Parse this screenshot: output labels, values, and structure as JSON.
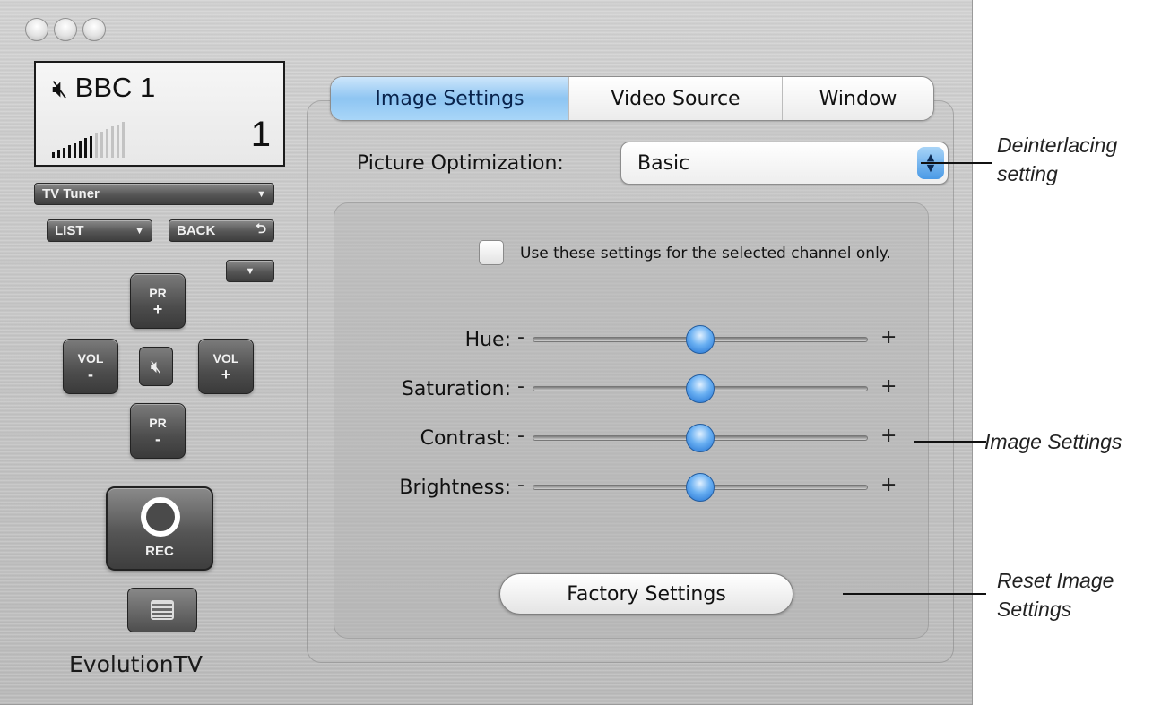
{
  "lcd": {
    "channel": "BBC 1",
    "channel_number": "1",
    "signal_level": 0.55
  },
  "left_controls": {
    "source_select": "TV Tuner",
    "list_button": "LIST",
    "back_button": "BACK",
    "pr_plus_top": "PR",
    "pr_plus_bottom": "+",
    "pr_minus_top": "PR",
    "pr_minus_bottom": "-",
    "vol_minus_top": "VOL",
    "vol_minus_bottom": "-",
    "vol_plus_top": "VOL",
    "vol_plus_bottom": "+",
    "rec_label": "REC",
    "brand": "EvolutionTV"
  },
  "tabs": [
    {
      "label": "Image Settings",
      "selected": true
    },
    {
      "label": "Video Source",
      "selected": false
    },
    {
      "label": "Window",
      "selected": false
    }
  ],
  "picture_optimization": {
    "label": "Picture Optimization:",
    "value": "Basic"
  },
  "channel_only_checkbox": {
    "label": "Use these settings for the selected channel only.",
    "checked": false
  },
  "sliders": [
    {
      "label": "Hue:",
      "minus": "-",
      "plus": "+",
      "value": 0.5
    },
    {
      "label": "Saturation:",
      "minus": "-",
      "plus": "+",
      "value": 0.5
    },
    {
      "label": "Contrast:",
      "minus": "-",
      "plus": "+",
      "value": 0.5
    },
    {
      "label": "Brightness:",
      "minus": "-",
      "plus": "+",
      "value": 0.5
    }
  ],
  "factory_button": "Factory Settings",
  "callouts": {
    "deinterlacing_1": "Deinterlacing",
    "deinterlacing_2": "setting",
    "image_settings": "Image Settings",
    "reset_1": "Reset Image",
    "reset_2": "Settings"
  },
  "colors": {
    "selected_tab": "#8ec5f2",
    "slider_thumb": "#1f6fd0"
  }
}
